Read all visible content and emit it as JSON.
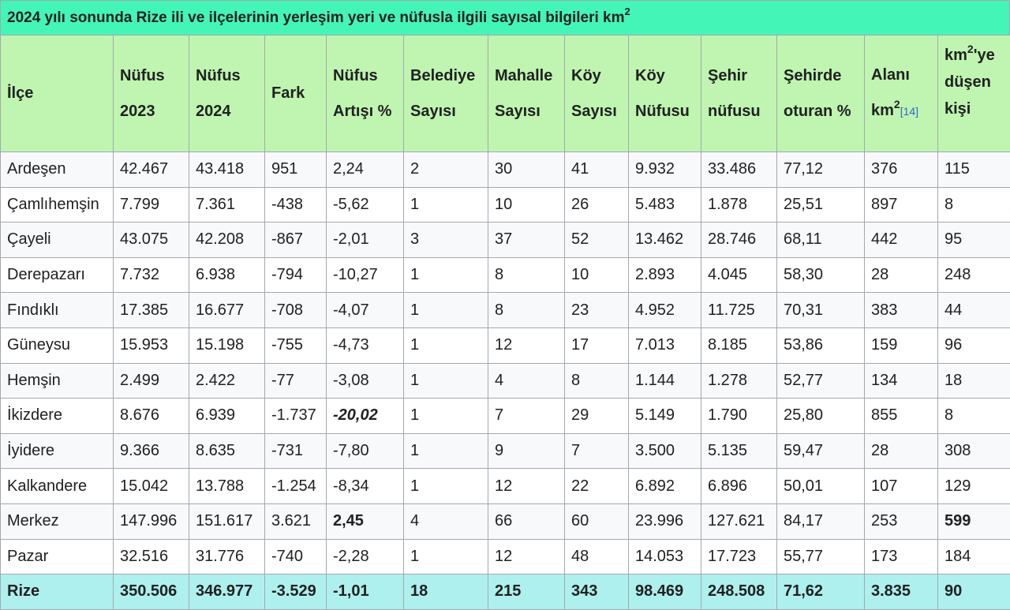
{
  "caption": {
    "text": "2024 yılı sonunda Rize ili ve ilçelerinin yerleşim yeri ve nüfusla ilgili sayısal bilgileri km",
    "sup": "2"
  },
  "headers": {
    "ilce": "İlçe",
    "nufus2023": [
      "Nüfus",
      "2023"
    ],
    "nufus2024": [
      "Nüfus",
      "2024"
    ],
    "fark": "Fark",
    "artis": [
      "Nüfus",
      "Artışı %"
    ],
    "belediye": [
      "Belediye",
      "Sayısı"
    ],
    "mahalle": [
      "Mahalle",
      "Sayısı"
    ],
    "koy": [
      "Köy",
      "Sayısı"
    ],
    "koyNufus": [
      "Köy",
      "Nüfusu"
    ],
    "sehir": [
      "Şehir",
      "nüfusu"
    ],
    "sehirde": [
      "Şehirde",
      "oturan %"
    ],
    "alan": {
      "l1": "Alanı",
      "l2": "km",
      "sup": "2",
      "ref": "[14]"
    },
    "yogunluk": {
      "l1a": "km",
      "l1sup": "2",
      "l1b": "'ye",
      "l2": "düşen",
      "l3": "kişi"
    }
  },
  "rows": [
    [
      "Ardeşen",
      "42.467",
      "43.418",
      "951",
      "2,24",
      "2",
      "30",
      "41",
      "9.932",
      "33.486",
      "77,12",
      "376",
      "115"
    ],
    [
      "Çamlıhemşin",
      "7.799",
      "7.361",
      "-438",
      "-5,62",
      "1",
      "10",
      "26",
      "5.483",
      "1.878",
      "25,51",
      "897",
      "8"
    ],
    [
      "Çayeli",
      "43.075",
      "42.208",
      "-867",
      "-2,01",
      "3",
      "37",
      "52",
      "13.462",
      "28.746",
      "68,11",
      "442",
      "95"
    ],
    [
      "Derepazarı",
      "7.732",
      "6.938",
      "-794",
      "-10,27",
      "1",
      "8",
      "10",
      "2.893",
      "4.045",
      "58,30",
      "28",
      "248"
    ],
    [
      "Fındıklı",
      "17.385",
      "16.677",
      "-708",
      "-4,07",
      "1",
      "8",
      "23",
      "4.952",
      "11.725",
      "70,31",
      "383",
      "44"
    ],
    [
      "Güneysu",
      "15.953",
      "15.198",
      "-755",
      "-4,73",
      "1",
      "12",
      "17",
      "7.013",
      "8.185",
      "53,86",
      "159",
      "96"
    ],
    [
      "Hemşin",
      "2.499",
      "2.422",
      "-77",
      "-3,08",
      "1",
      "4",
      "8",
      "1.144",
      "1.278",
      "52,77",
      "134",
      "18"
    ],
    [
      "İkizdere",
      "8.676",
      "6.939",
      "-1.737",
      "-20,02",
      "1",
      "7",
      "29",
      "5.149",
      "1.790",
      "25,80",
      "855",
      "8"
    ],
    [
      "İyidere",
      "9.366",
      "8.635",
      "-731",
      "-7,80",
      "1",
      "9",
      "7",
      "3.500",
      "5.135",
      "59,47",
      "28",
      "308"
    ],
    [
      "Kalkandere",
      "15.042",
      "13.788",
      "-1.254",
      "-8,34",
      "1",
      "12",
      "22",
      "6.892",
      "6.896",
      "50,01",
      "107",
      "129"
    ],
    [
      "Merkez",
      "147.996",
      "151.617",
      "3.621",
      "2,45",
      "4",
      "66",
      "60",
      "23.996",
      "127.621",
      "84,17",
      "253",
      "599"
    ],
    [
      "Pazar",
      "32.516",
      "31.776",
      "-740",
      "-2,28",
      "1",
      "12",
      "48",
      "14.053",
      "17.723",
      "55,77",
      "173",
      "184"
    ]
  ],
  "total": [
    "Rize",
    "350.506",
    "346.977",
    "-3.529",
    "-1,01",
    "18",
    "215",
    "343",
    "98.469",
    "248.508",
    "71,62",
    "3.835",
    "90"
  ],
  "highlights": {
    "italic_bold": [
      [
        7,
        4
      ]
    ],
    "bold": [
      [
        10,
        4
      ],
      [
        10,
        12
      ]
    ]
  },
  "colors": {
    "caption_bg": "#44f5b8",
    "header_bg": "#bff5b0",
    "total_bg": "#aef0ee",
    "border": "#a2a9b1"
  }
}
